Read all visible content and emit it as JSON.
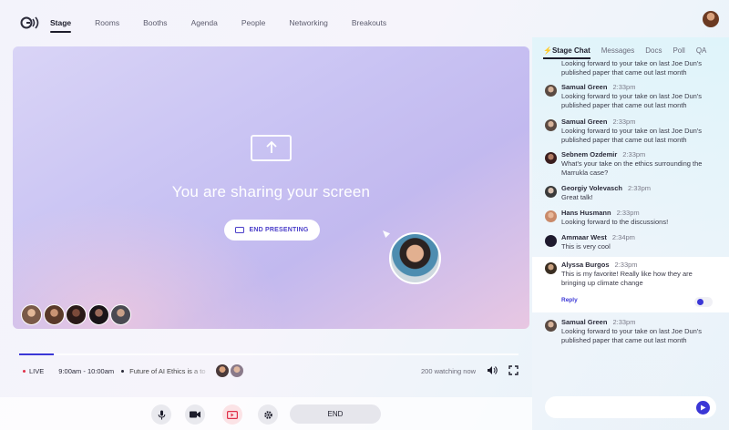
{
  "nav": {
    "tabs": [
      "Stage",
      "Rooms",
      "Booths",
      "Agenda",
      "People",
      "Networking",
      "Breakouts"
    ],
    "active": "Stage"
  },
  "stage": {
    "share_message": "You are sharing your screen",
    "end_presenting_label": "END PRESENTING"
  },
  "playback": {
    "progress_fraction": 0.07,
    "live_label": "LIVE",
    "time_range": "9:00am - 10:00am",
    "session_title": "Future of AI Ethics is a to",
    "watching": "200 watching now"
  },
  "controls": {
    "end_label": "END"
  },
  "panel": {
    "tabs": [
      "Stage Chat",
      "Messages",
      "Docs",
      "Poll",
      "QA"
    ],
    "active_tab": "Stage Chat",
    "reply_label": "Reply",
    "messages": [
      {
        "name": "",
        "time": "",
        "text": "Looking forward to your take on last Joe Dun's published paper that came out last month",
        "color": "#8a6b5a",
        "cut": true
      },
      {
        "name": "Samual Green",
        "time": "2:33pm",
        "text": "Looking forward to your take on last Joe Dun's published paper that came out last month",
        "color": "#8a6b5a"
      },
      {
        "name": "Samual Green",
        "time": "2:33pm",
        "text": "Looking forward to your take on last Joe Dun's published paper that came out last month",
        "color": "#8a6b5a"
      },
      {
        "name": "Sebnem Ozdemir",
        "time": "2:33pm",
        "text": "What's your take on the ethics surrounding the Marrukla case?",
        "color": "#6b3d3a"
      },
      {
        "name": "Georgiy Volevasch",
        "time": "2:33pm",
        "text": "Great talk!",
        "color": "#5a5a5a"
      },
      {
        "name": "Hans Husmann",
        "time": "2:33pm",
        "text": "Looking forward to the discussions!",
        "color": "#c98a6a"
      },
      {
        "name": "Ammaar West",
        "time": "2:34pm",
        "text": "This is very cool",
        "color": "#1e1a2e"
      },
      {
        "name": "Alyssa Burgos",
        "time": "2:33pm",
        "text": "This is my favorite! Really like how they are bringing up climate change",
        "color": "#4a3a2e",
        "highlight": true
      },
      {
        "name": "Samual Green",
        "time": "2:33pm",
        "text": "Looking forward to your take on last Joe Dun's published paper that came out last month",
        "color": "#8a6b5a"
      }
    ]
  },
  "colors": {
    "accent": "#3b37d6",
    "live": "#e0314a"
  }
}
